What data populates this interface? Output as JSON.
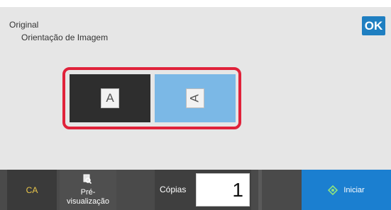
{
  "header": {
    "title": "Original",
    "subtitle": "Orientação de Imagem",
    "ok_label": "OK"
  },
  "orientation": {
    "options": [
      {
        "glyph": "A",
        "selected": true
      },
      {
        "glyph": "A",
        "selected": false
      }
    ]
  },
  "bottom_bar": {
    "ca_label": "CA",
    "preview_label": "Pré-\nvisualização",
    "copies_label": "Cópias",
    "copies_value": "1",
    "start_label": "Iniciar"
  },
  "colors": {
    "ok_button": "#1f7fc1",
    "selection_frame": "#e0223a",
    "start_button": "#1b7fd0"
  },
  "icons": {
    "preview": "magnifier-document-icon",
    "start": "diamond-start-icon"
  }
}
